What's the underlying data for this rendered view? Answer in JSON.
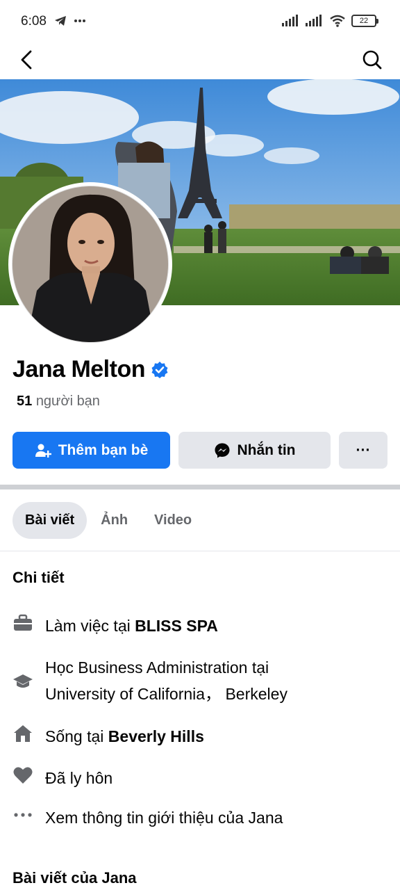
{
  "status_bar": {
    "time": "6:08",
    "battery": "22"
  },
  "profile": {
    "name": "Jana Melton",
    "friends_count": "51",
    "friends_label": "người bạn"
  },
  "actions": {
    "add_friend": "Thêm bạn bè",
    "message": "Nhắn tin",
    "more": "···"
  },
  "tabs": [
    {
      "label": "Bài viết",
      "active": true
    },
    {
      "label": "Ảnh",
      "active": false
    },
    {
      "label": "Video",
      "active": false
    }
  ],
  "details": {
    "title": "Chi tiết",
    "work": {
      "prefix": "Làm việc tại ",
      "value": "BLISS SPA"
    },
    "education": {
      "line1": "Học Business Administration tại",
      "line2": "University of California， Berkeley"
    },
    "lives": {
      "prefix": "Sống tại ",
      "value": "Beverly Hills"
    },
    "relationship": "Đã ly hôn",
    "see_about": "Xem thông tin giới thiệu của Jana"
  },
  "posts_title": "Bài viết của Jana",
  "colors": {
    "accent": "#1877f2",
    "verified": "#1877f2",
    "button_gray": "#e4e6eb"
  }
}
